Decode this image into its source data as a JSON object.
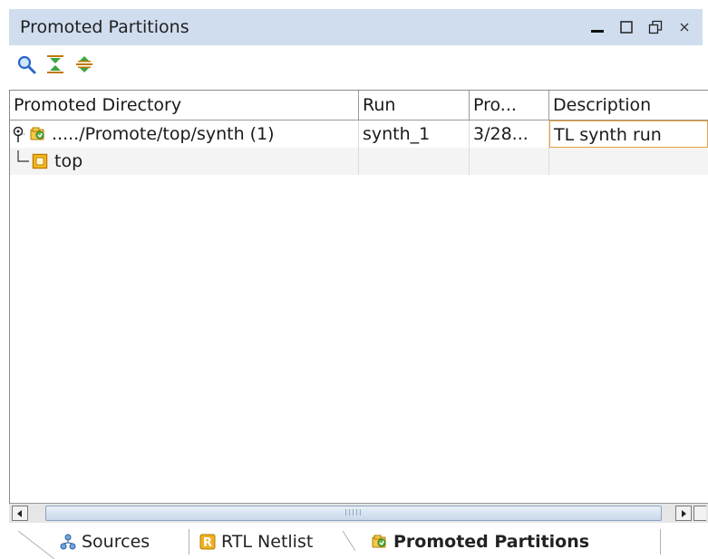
{
  "window": {
    "title": "Promoted Partitions",
    "controls": [
      "minimize-icon",
      "maximize-icon",
      "restore-icon",
      "close-icon"
    ]
  },
  "toolbar": {
    "buttons": [
      {
        "icon": "search-icon"
      },
      {
        "icon": "collapse-all-icon"
      },
      {
        "icon": "expand-all-icon"
      }
    ]
  },
  "table": {
    "columns": [
      "Promoted Directory",
      "Run",
      "Pro...",
      "Description"
    ],
    "rows": [
      {
        "directory": "...../Promote/top/synth (1)",
        "run": "synth_1",
        "promoted": "3/28...",
        "description": "TL synth run",
        "expanded": true,
        "level": 0
      },
      {
        "directory": "top",
        "run": "",
        "promoted": "",
        "description": "",
        "level": 1
      }
    ]
  },
  "scrollbar": {
    "grip": "IIIII"
  },
  "tabs": [
    {
      "label": "Sources",
      "icon": "sources-icon",
      "active": false
    },
    {
      "label": "RTL Netlist",
      "icon": "rtl-netlist-icon",
      "active": false
    },
    {
      "label": "Promoted Partitions",
      "icon": "promoted-partitions-icon",
      "active": true
    }
  ],
  "colors": {
    "titlebar_bg": "#cfddef",
    "edit_border": "#e8a040",
    "partition_icon": "#f0a800"
  }
}
